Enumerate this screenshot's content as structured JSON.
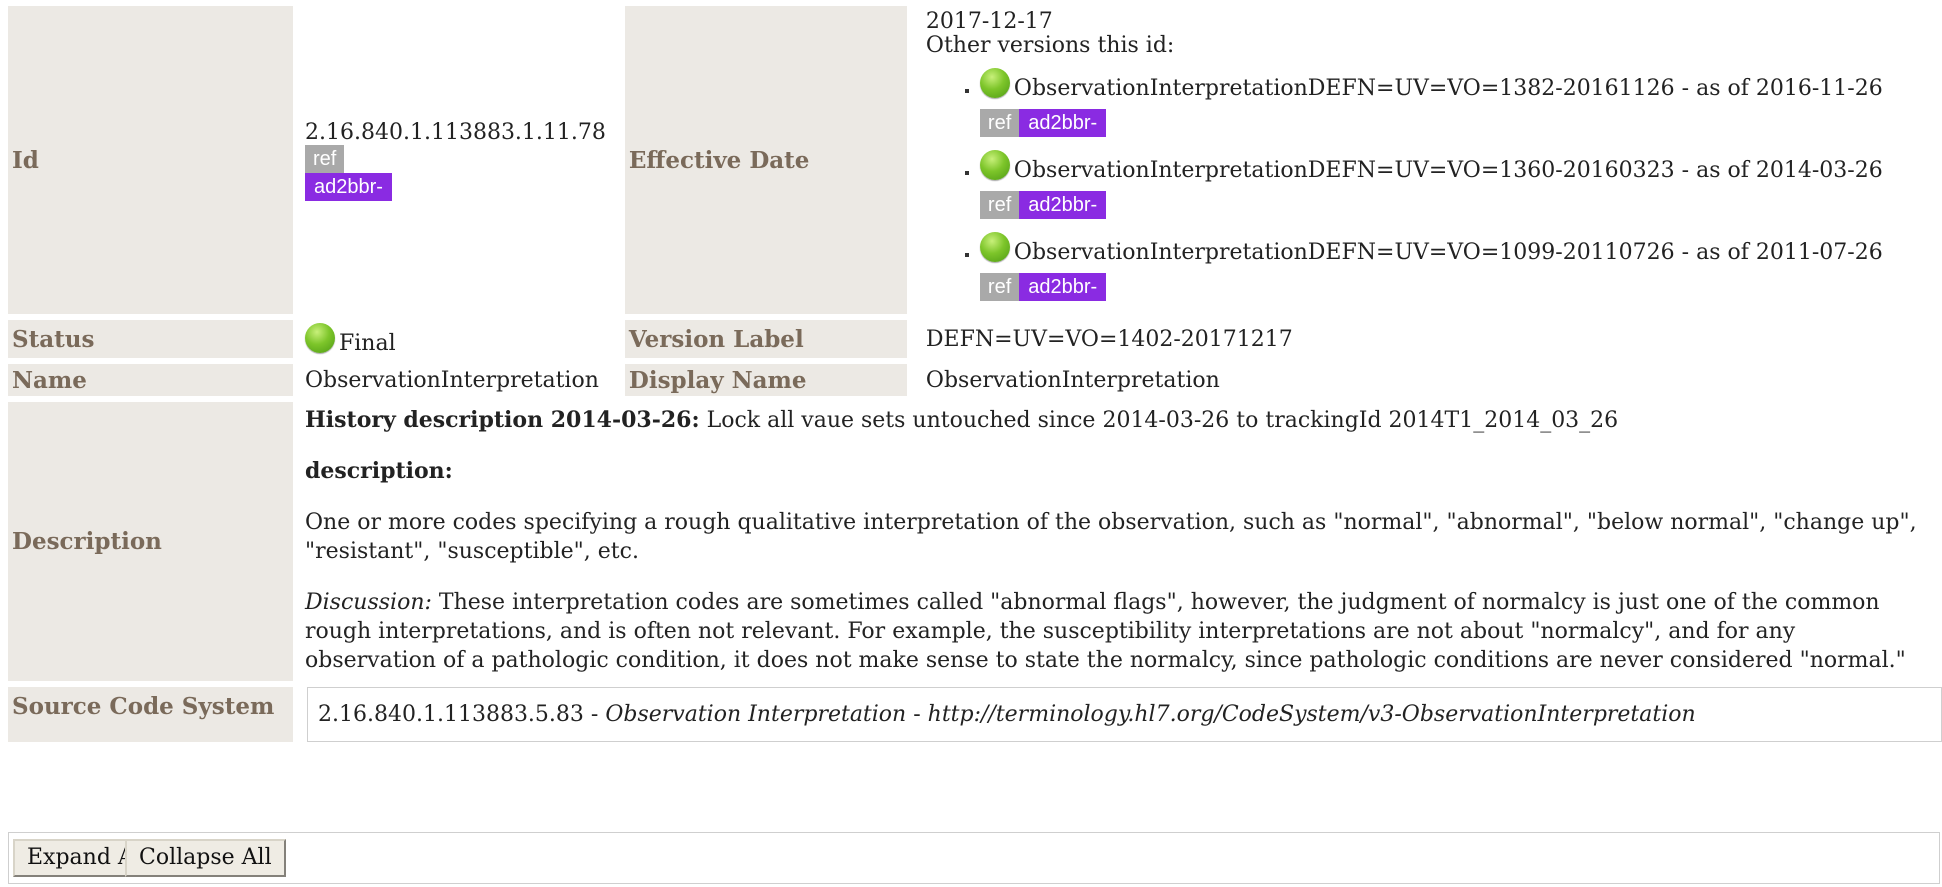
{
  "id": {
    "label": "Id",
    "value": "2.16.840.1.113883.1.11.78",
    "ref_badge": "ref",
    "source_badge": "ad2bbr-"
  },
  "effective_date": {
    "label": "Effective Date",
    "date": "2017-12-17",
    "other_versions_label": "Other versions this id:",
    "versions": [
      {
        "text": "ObservationInterpretationDEFN=UV=VO=1382-20161126 - as of 2016-11-26",
        "ref_badge": "ref",
        "source_badge": "ad2bbr-"
      },
      {
        "text": "ObservationInterpretationDEFN=UV=VO=1360-20160323 - as of 2014-03-26",
        "ref_badge": "ref",
        "source_badge": "ad2bbr-"
      },
      {
        "text": "ObservationInterpretationDEFN=UV=VO=1099-20110726 - as of 2011-07-26",
        "ref_badge": "ref",
        "source_badge": "ad2bbr-"
      }
    ]
  },
  "status": {
    "label": "Status",
    "value": "Final"
  },
  "version_label": {
    "label": "Version Label",
    "value": "DEFN=UV=VO=1402-20171217"
  },
  "name": {
    "label": "Name",
    "value": "ObservationInterpretation"
  },
  "display_name": {
    "label": "Display Name",
    "value": "ObservationInterpretation"
  },
  "description": {
    "label": "Description",
    "history_title": "History description 2014-03-26:",
    "history_text": "Lock all vaue sets untouched since 2014-03-26 to trackingId 2014T1_2014_03_26",
    "desc_title": "description:",
    "desc_text": "One or more codes specifying a rough qualitative interpretation of the observation, such as \"normal\", \"abnormal\", \"below normal\", \"change up\", \"resistant\", \"susceptible\", etc.",
    "discussion_label": "Discussion:",
    "discussion_text": "These interpretation codes are sometimes called \"abnormal flags\", however, the judgment of normalcy is just one of the common rough interpretations, and is often not relevant. For example, the susceptibility interpretations are not about \"normalcy\", and for any observation of a pathologic condition, it does not make sense to state the normalcy, since pathologic conditions are never considered \"normal.\""
  },
  "source_code_system": {
    "label": "Source Code System",
    "oid": "2.16.840.1.113883.5.83",
    "sep1": " - ",
    "name": "Observation Interpretation",
    "sep2": " - ",
    "url": "http://terminology.hl7.org/CodeSystem/v3-ObservationInterpretation"
  },
  "buttons": {
    "expand_all": "Expand All",
    "collapse_all": "Collapse All"
  },
  "colors": {
    "label_bg": "#ece9e4",
    "label_text": "#7a6a5a",
    "ref_badge": "#a9a9a9",
    "source_badge": "#8a2be2",
    "status_final": "#7dc52a"
  }
}
